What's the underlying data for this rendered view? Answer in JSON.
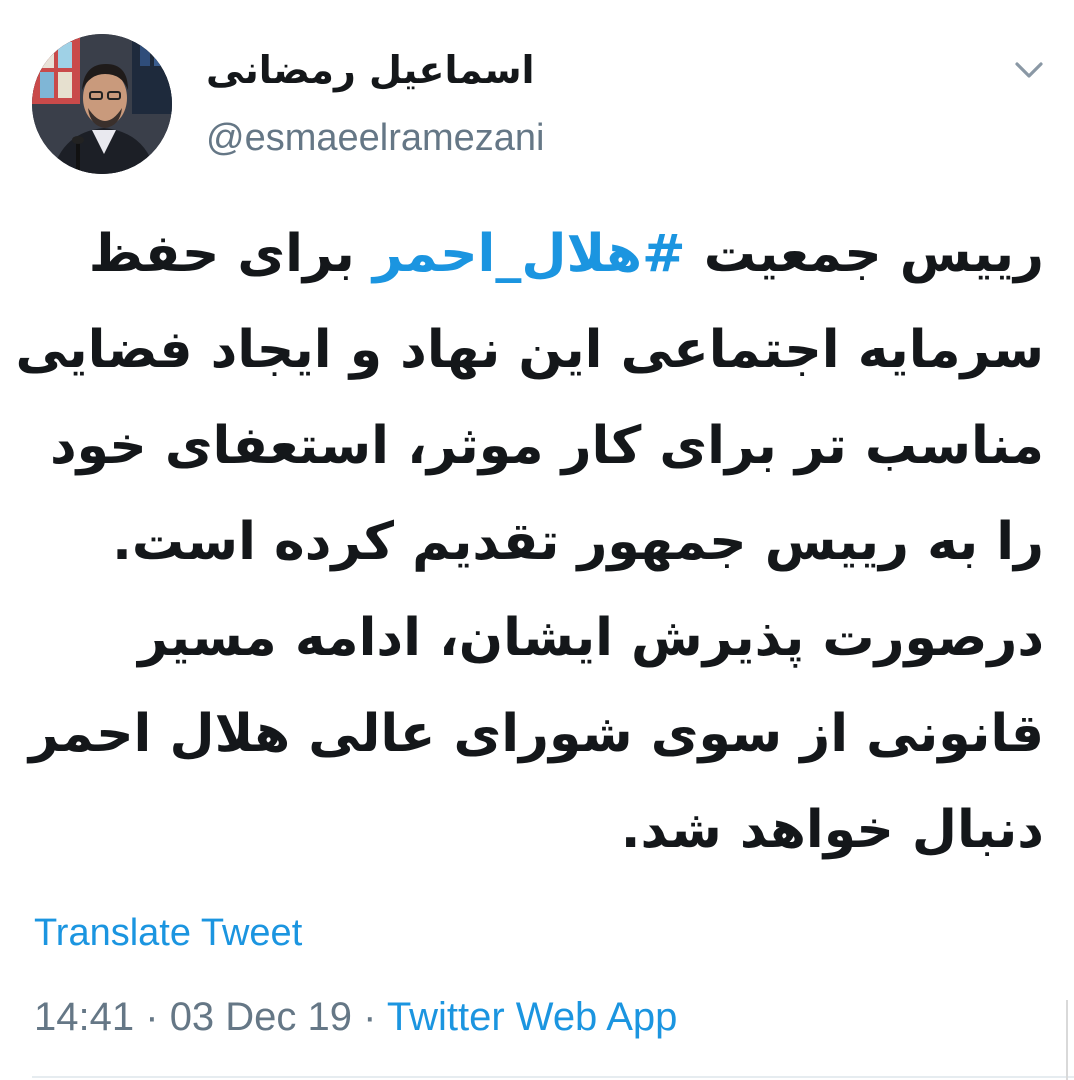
{
  "author": {
    "display_name": "اسماعیل رمضانی",
    "handle": "@esmaeelramezani"
  },
  "tweet": {
    "lines": [
      {
        "before": "رییس جمعیت ",
        "hashtag": "#هلال_احمر",
        "after": " برای حفظ"
      },
      {
        "text": "سرمایه اجتماعی این نهاد و ایجاد فضایی"
      },
      {
        "text": "مناسب تر برای کار موثر، استعفای خود"
      },
      {
        "text": "را به رییس جمهور تقدیم کرده است."
      },
      {
        "text": "درصورت پذیرش ایشان، ادامه مسیر"
      },
      {
        "text": "قانونی از سوی شورای عالی هلال احمر"
      },
      {
        "text": "دنبال خواهد شد."
      }
    ],
    "translate_label": "Translate Tweet",
    "time": "14:41",
    "separator": "·",
    "date": "03 Dec 19",
    "source": "Twitter Web App"
  },
  "icons": {
    "menu": "chevron-down-icon"
  },
  "colors": {
    "link": "#1b95e0",
    "secondary_text": "#657786",
    "primary_text": "#14171a",
    "background": "#ffffff"
  }
}
